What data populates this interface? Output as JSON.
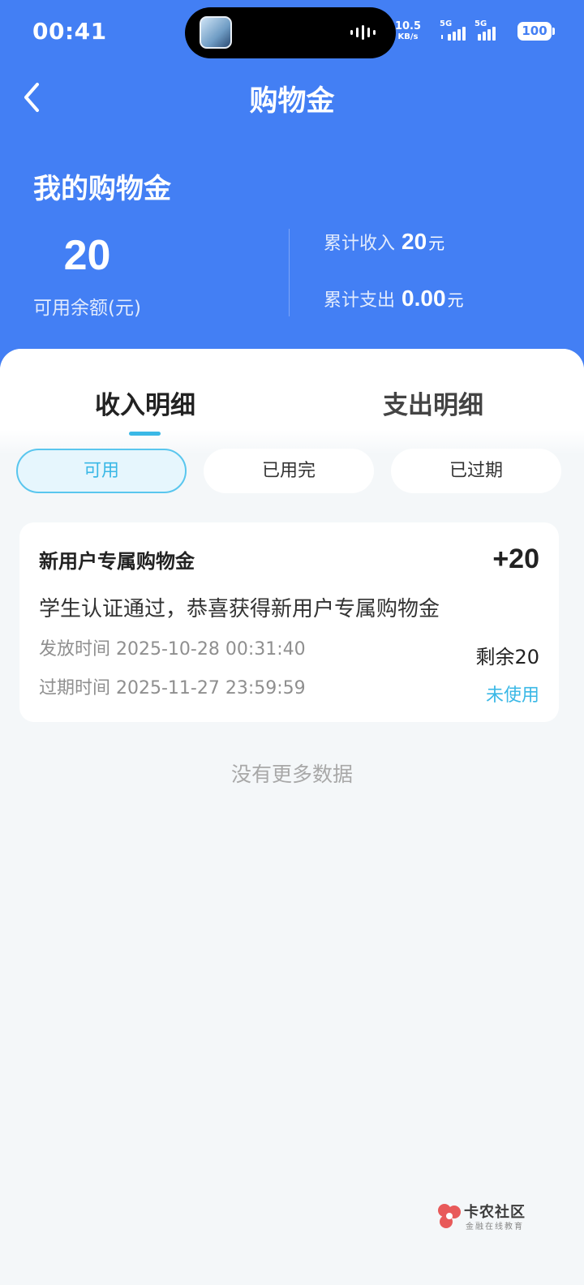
{
  "status_bar": {
    "time": "00:41",
    "net_speed_value": "10.5",
    "net_speed_unit": "KB/s",
    "sim1_label": "5G",
    "sim2_label": "5G",
    "battery": "100"
  },
  "nav": {
    "title": "购物金",
    "back_icon": "chevron-left-icon"
  },
  "summary": {
    "title": "我的购物金",
    "balance": "20",
    "balance_label": "可用余额(元)",
    "income_label": "累计收入",
    "income_value": "20",
    "income_unit": "元",
    "expense_label": "累计支出",
    "expense_value": "0.00",
    "expense_unit": "元"
  },
  "tabs": {
    "income": "收入明细",
    "expense": "支出明细",
    "active": "income"
  },
  "filters": {
    "available": "可用",
    "used_up": "已用完",
    "expired": "已过期",
    "active": "available"
  },
  "records": [
    {
      "title": "新用户专属购物金",
      "amount": "+20",
      "description": "学生认证通过，恭喜获得新用户专属购物金",
      "issue_time": "发放时间 2025-10-28 00:31:40",
      "expire_time": "过期时间 2025-11-27 23:59:59",
      "remaining": "剩余20",
      "status": "未使用"
    }
  ],
  "footer": {
    "no_more": "没有更多数据"
  },
  "watermark": {
    "name": "卡农社区",
    "sub": "金融在线教育"
  },
  "colors": {
    "header_blue": "#437ff4",
    "accent_cyan": "#3ab8e6",
    "page_bg": "#f4f7f9"
  }
}
